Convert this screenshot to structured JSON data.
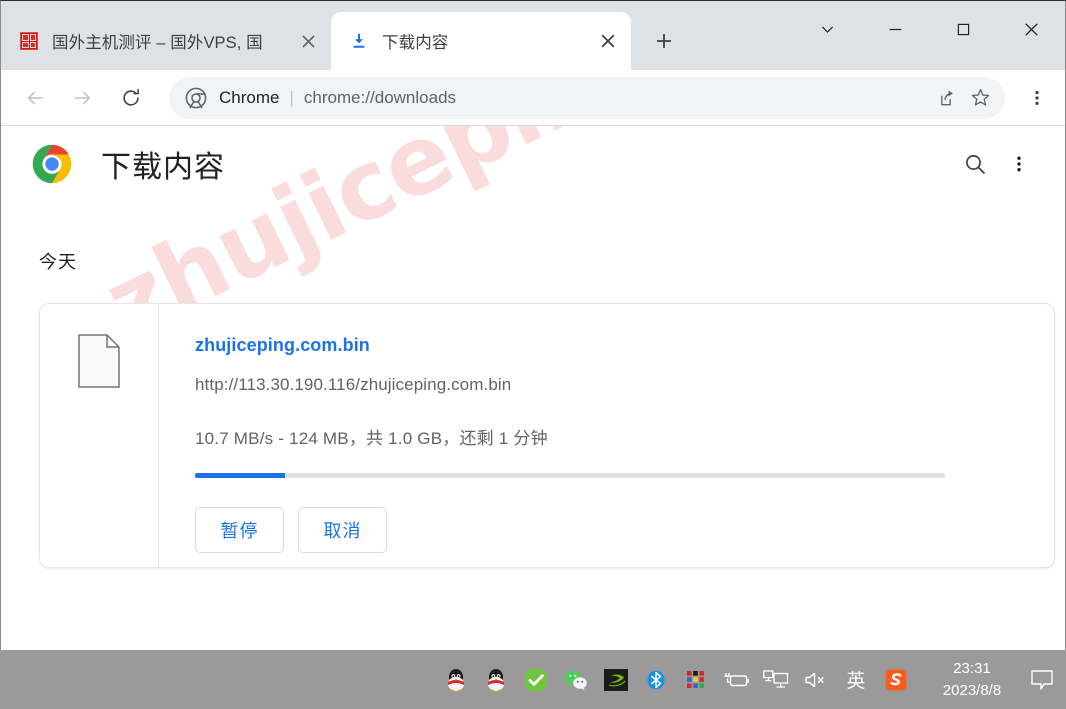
{
  "window": {
    "controls": [
      {
        "name": "tab-search",
        "glyph": "chevron-down"
      },
      {
        "name": "minimize",
        "glyph": "minus"
      },
      {
        "name": "maximize",
        "glyph": "square"
      },
      {
        "name": "close",
        "glyph": "cross"
      }
    ]
  },
  "tabs": [
    {
      "title": "国外主机测评 – 国外VPS, 国",
      "favicon": "seal-icon",
      "active": false,
      "close_label": "×"
    },
    {
      "title": "下载内容",
      "favicon": "download-icon",
      "active": true,
      "close_label": "×"
    }
  ],
  "new_tab_label": "+",
  "toolbar": {
    "back_label": "←",
    "forward_label": "→",
    "reload_label": "⟳",
    "omnibox": {
      "chip_label": "Chrome",
      "separator": "|",
      "url": "chrome://downloads"
    },
    "share_label": "share-icon",
    "bookmark_label": "star-icon",
    "menu_label": "⋮"
  },
  "page": {
    "title": "下载内容",
    "search_label": "search-icon",
    "menu_label": "⋮",
    "watermark": "zhujiceping.com",
    "group_label": "今天",
    "accent_color": "#1a73e8",
    "download": {
      "file_name": "zhujiceping.com.bin",
      "url": "http://113.30.190.116/zhujiceping.com.bin",
      "status": "10.7 MB/s - 124 MB，共 1.0 GB，还剩 1 分钟",
      "progress_percent": 12,
      "buttons": [
        {
          "label": "暂停",
          "name": "pause-download-button"
        },
        {
          "label": "取消",
          "name": "cancel-download-button"
        }
      ]
    }
  },
  "taskbar": {
    "tray": [
      {
        "name": "qq-icon",
        "title": "QQ"
      },
      {
        "name": "qq-icon-2",
        "title": "QQ"
      },
      {
        "name": "checkmark-icon",
        "title": "360"
      },
      {
        "name": "wechat-icon",
        "title": "WeChat"
      },
      {
        "name": "nvidia-icon",
        "title": "NVIDIA"
      },
      {
        "name": "bluetooth-icon",
        "title": "Bluetooth"
      },
      {
        "name": "app-grid-icon",
        "title": "Apps"
      },
      {
        "name": "battery-charging-icon",
        "title": "Battery"
      },
      {
        "name": "network-icon",
        "title": "Network"
      },
      {
        "name": "volume-muted-icon",
        "title": "Volume muted"
      },
      {
        "name": "ime-icon",
        "title": "英"
      },
      {
        "name": "sogou-icon",
        "title": "Sogou"
      }
    ],
    "ime_label": "英",
    "sogou_label": "S",
    "clock": {
      "time": "23:31",
      "date": "2023/8/8"
    },
    "notification_label": "notification-icon"
  }
}
